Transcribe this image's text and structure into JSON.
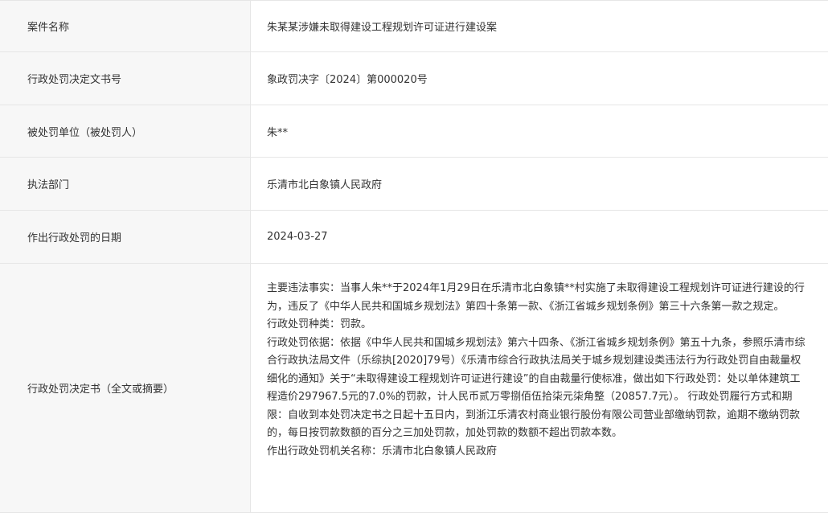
{
  "rows": [
    {
      "label": "案件名称",
      "value": "朱某某涉嫌未取得建设工程规划许可证进行建设案"
    },
    {
      "label": "行政处罚决定文书号",
      "value": "象政罚决字〔2024〕第000020号"
    },
    {
      "label": "被处罚单位（被处罚人）",
      "value": "朱**"
    },
    {
      "label": "执法部门",
      "value": "乐清市北白象镇人民政府"
    },
    {
      "label": "作出行政处罚的日期",
      "value": "2024-03-27"
    }
  ],
  "decision": {
    "label": "行政处罚决定书（全文或摘要）",
    "facts": "主要违法事实：当事人朱**于2024年1月29日在乐清市北白象镇**村实施了未取得建设工程规划许可证进行建设的行为，违反了《中华人民共和国城乡规划法》第四十条第一款、《浙江省城乡规划条例》第三十六条第一款之规定。",
    "type": "行政处罚种类：罚款。",
    "basis": "行政处罚依据：依据《中华人民共和国城乡规划法》第六十四条、《浙江省城乡规划条例》第五十九条，参照乐清市综合行政执法局文件（乐综执[2020]79号）《乐清市综合行政执法局关于城乡规划建设类违法行为行政处罚自由裁量权细化的通知》关于“未取得建设工程规划许可证进行建设”的自由裁量行使标准，做出如下行政处罚：处以单体建筑工程造价297967.5元的7.0%的罚款，计人民币贰万零捌佰伍拾柒元柒角整（20857.7元）。 行政处罚履行方式和期限：自收到本处罚决定书之日起十五日内，到浙江乐清农村商业银行股份有限公司营业部缴纳罚款，逾期不缴纳罚款的，每日按罚款数额的百分之三加处罚款，加处罚款的数额不超出罚款本数。",
    "authority": "作出行政处罚机关名称：乐清市北白象镇人民政府"
  }
}
